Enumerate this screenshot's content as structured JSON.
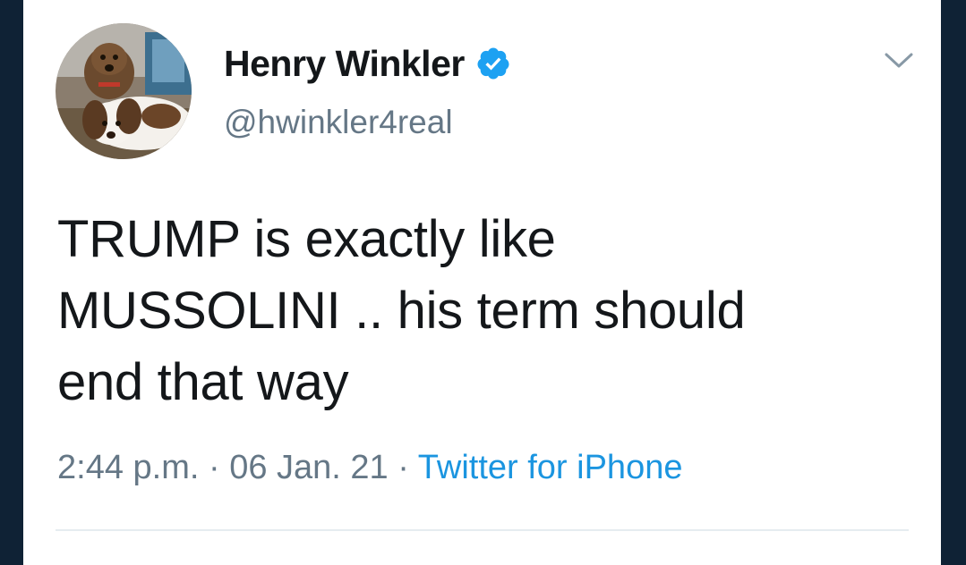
{
  "tweet": {
    "author": {
      "display_name": "Henry Winkler",
      "handle": "@hwinkler4real",
      "verified": true,
      "avatar_icon": "profile-photo-two-dogs"
    },
    "text": "TRUMP is exactly like\nMUSSOLINI .. his term should\nend that way",
    "timestamp": "2:44 p.m.",
    "separator": "·",
    "date": "06 Jan. 21",
    "source": "Twitter for iPhone",
    "menu_icon": "chevron-down-icon"
  },
  "colors": {
    "background": "#0f2235",
    "card": "#ffffff",
    "text_primary": "#14171a",
    "text_secondary": "#657786",
    "link": "#1b95e0",
    "verified_badge": "#1da1f2"
  }
}
